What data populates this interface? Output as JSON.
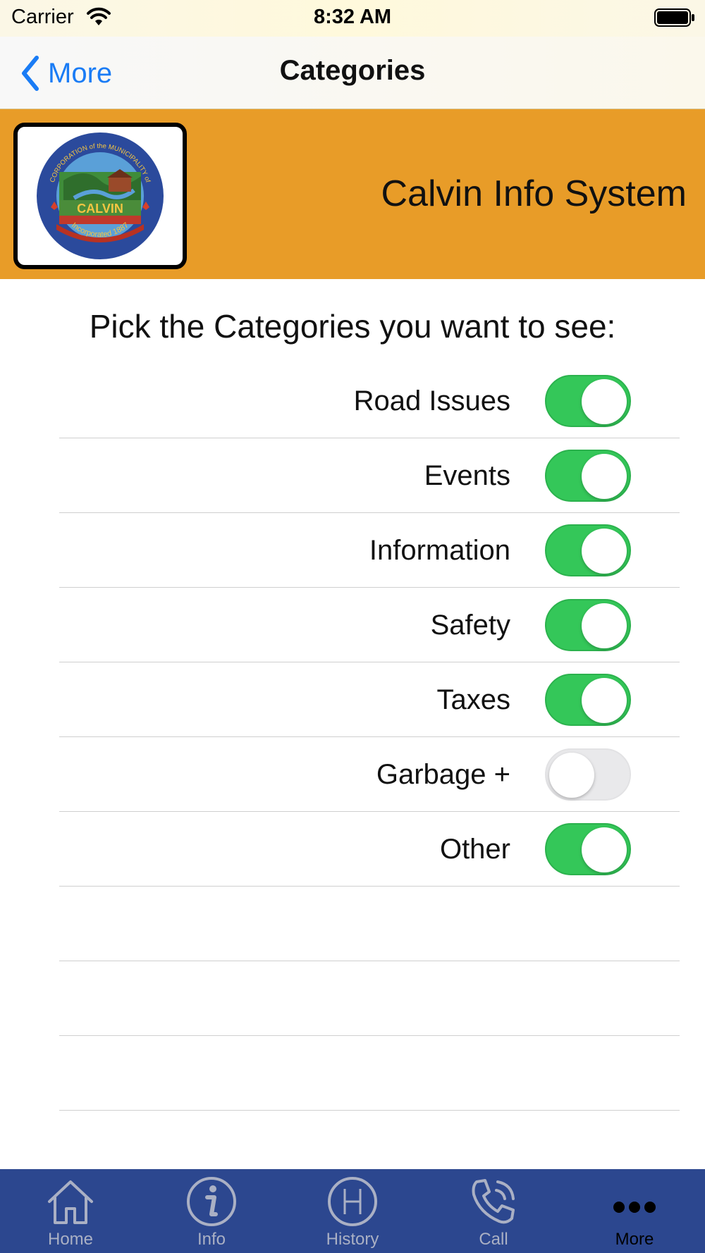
{
  "status_bar": {
    "carrier": "Carrier",
    "time": "8:32 AM"
  },
  "nav": {
    "back_label": "More",
    "title": "Categories"
  },
  "banner": {
    "title": "Calvin Info System",
    "logo_text_top": "CORPORATION of the MUNICIPALITY of",
    "logo_text_name": "CALVIN",
    "logo_text_bottom": "Incorporated 1887",
    "color": "#e89c28"
  },
  "prompt": "Pick the Categories you want to see:",
  "categories": [
    {
      "label": "Road Issues",
      "enabled": true
    },
    {
      "label": "Events",
      "enabled": true
    },
    {
      "label": "Information",
      "enabled": true
    },
    {
      "label": "Safety",
      "enabled": true
    },
    {
      "label": "Taxes",
      "enabled": true
    },
    {
      "label": "Garbage +",
      "enabled": false
    },
    {
      "label": "Other",
      "enabled": true
    }
  ],
  "tabs": [
    {
      "label": "Home",
      "icon": "home-icon",
      "active": false
    },
    {
      "label": "Info",
      "icon": "info-icon",
      "active": false
    },
    {
      "label": "History",
      "icon": "history-icon",
      "active": false
    },
    {
      "label": "Call",
      "icon": "phone-icon",
      "active": false
    },
    {
      "label": "More",
      "icon": "more-icon",
      "active": true
    }
  ],
  "colors": {
    "accent_blue": "#1a7cf5",
    "toggle_on": "#34c759",
    "tab_bar": "#2c478f"
  }
}
